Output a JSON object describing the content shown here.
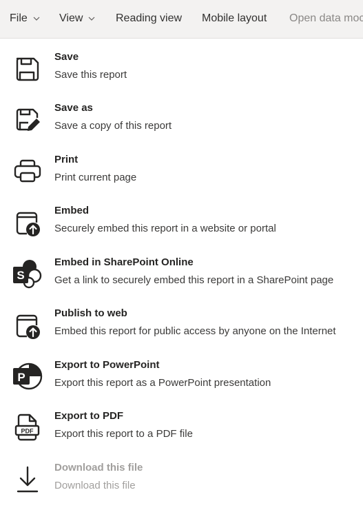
{
  "topbar": {
    "file": "File",
    "view": "View",
    "reading_view": "Reading view",
    "mobile_layout": "Mobile layout",
    "open_data_model": "Open data moc"
  },
  "menu": [
    {
      "title": "Save",
      "desc": "Save this report",
      "icon": "save-icon"
    },
    {
      "title": "Save as",
      "desc": "Save a copy of this report",
      "icon": "save-as-icon"
    },
    {
      "title": "Print",
      "desc": "Print current page",
      "icon": "printer-icon"
    },
    {
      "title": "Embed",
      "desc": "Securely embed this report in a website or portal",
      "icon": "embed-icon"
    },
    {
      "title": "Embed in SharePoint Online",
      "desc": "Get a link to securely embed this report in a SharePoint page",
      "icon": "sharepoint-icon"
    },
    {
      "title": "Publish to web",
      "desc": "Embed this report for public access by anyone on the Internet",
      "icon": "publish-web-icon"
    },
    {
      "title": "Export to PowerPoint",
      "desc": "Export this report as a PowerPoint presentation",
      "icon": "powerpoint-icon"
    },
    {
      "title": "Export to PDF",
      "desc": "Export this report to a PDF file",
      "icon": "pdf-icon"
    },
    {
      "title": "Download this file",
      "desc": "Download this file",
      "icon": "download-icon",
      "disabled": true
    }
  ],
  "colors": {
    "icon": "#252423",
    "disabled_text": "#a19f9d",
    "topbar_bg": "#f3f2f1"
  }
}
